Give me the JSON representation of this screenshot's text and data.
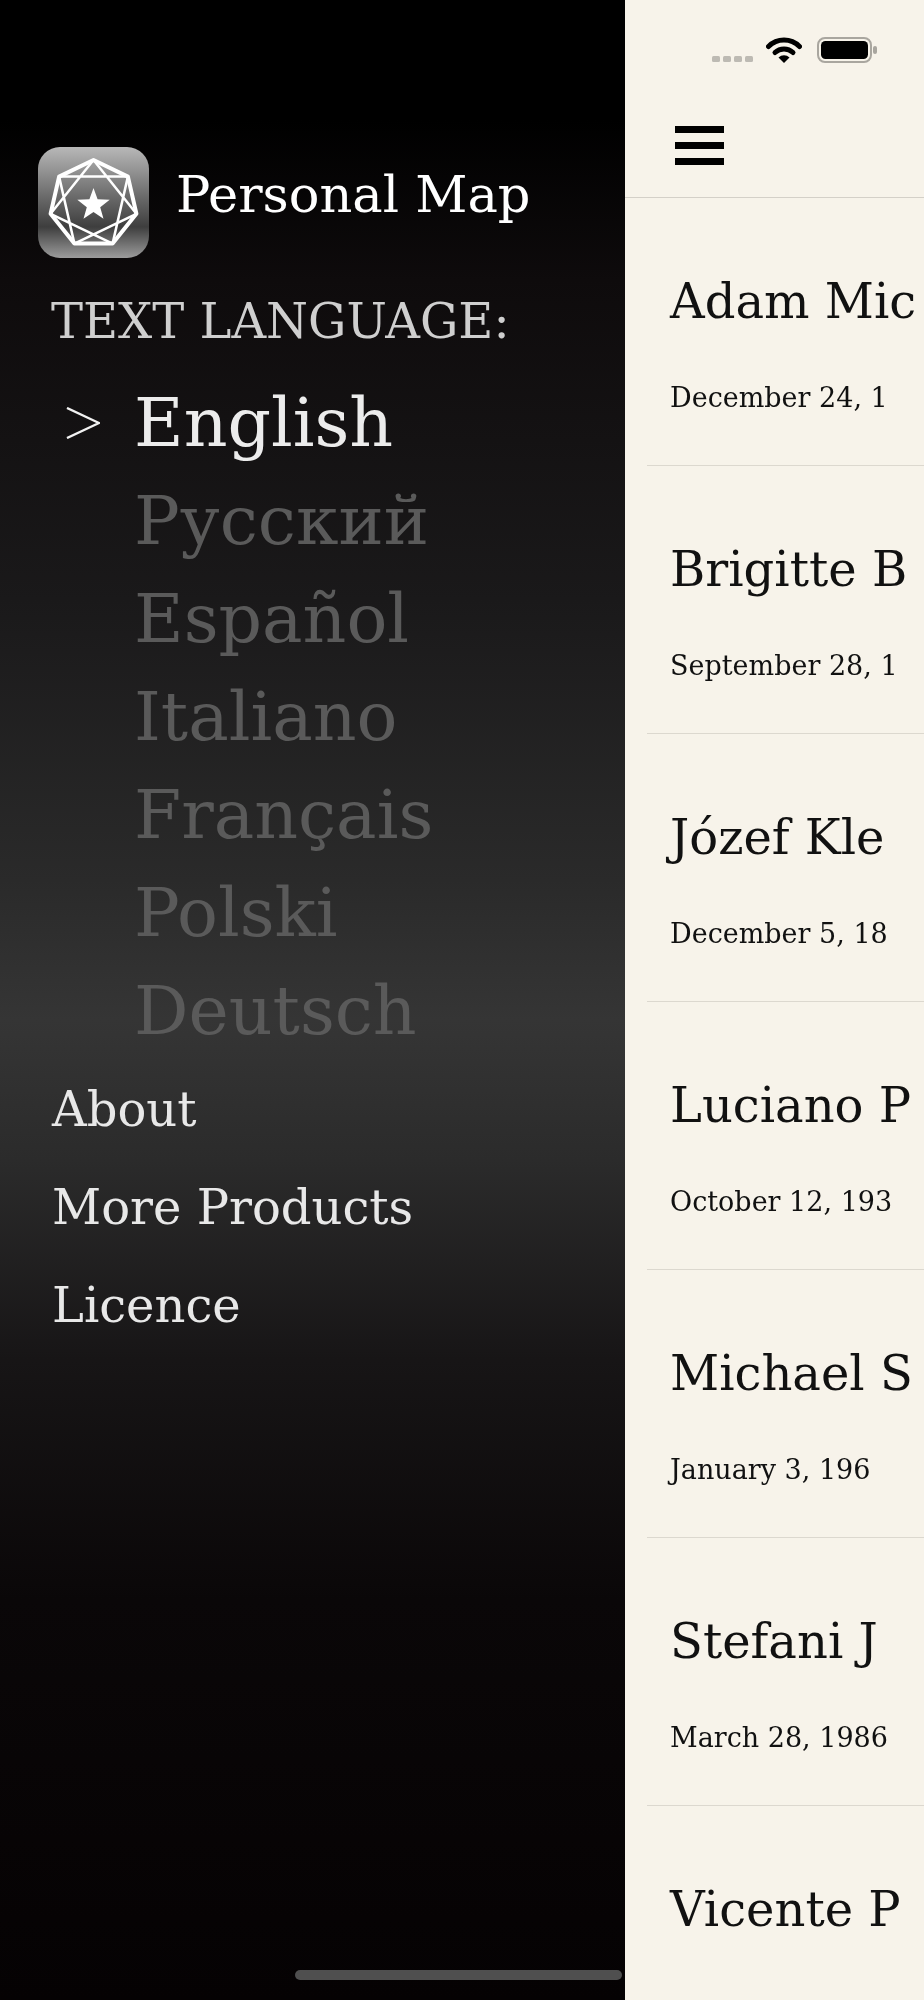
{
  "drawer": {
    "app_title": "Personal Map",
    "language_heading": "TEXT LANGUAGE:",
    "languages": [
      {
        "label": "English",
        "selected": true
      },
      {
        "label": "Русский",
        "selected": false
      },
      {
        "label": "Español",
        "selected": false
      },
      {
        "label": "Italiano",
        "selected": false
      },
      {
        "label": "Français",
        "selected": false
      },
      {
        "label": "Polski",
        "selected": false
      },
      {
        "label": "Deutsch",
        "selected": false
      }
    ],
    "menu_items": [
      "About",
      "More Products",
      "Licence"
    ]
  },
  "people_list": [
    {
      "name": "Adam Mic",
      "date": "December 24, 1"
    },
    {
      "name": "Brigitte B",
      "date": "September 28, 1"
    },
    {
      "name": "Józef Kle",
      "date": "December 5, 18"
    },
    {
      "name": "Luciano P",
      "date": "October 12, 193"
    },
    {
      "name": "Michael S",
      "date": "January 3, 196"
    },
    {
      "name": "Stefani J",
      "date": "March 28, 1986"
    },
    {
      "name": "Vicente P"
    }
  ]
}
